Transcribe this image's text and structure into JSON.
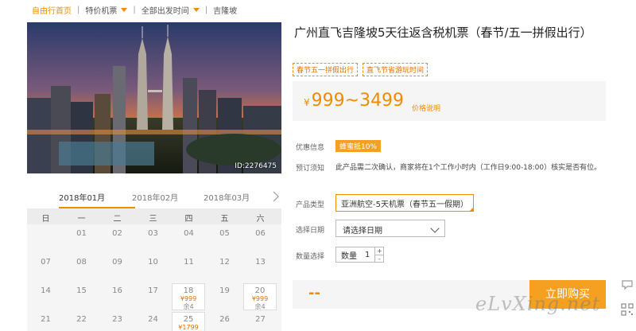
{
  "breadcrumb": {
    "home": "自由行首页",
    "items": [
      "特价机票",
      "全部出发时间",
      "吉隆坡"
    ]
  },
  "photo": {
    "id_label": "ID:2276475"
  },
  "calendar": {
    "months": [
      "2018年01月",
      "2018年02月",
      "2018年03月"
    ],
    "active_month_index": 0,
    "weekdays": [
      "日",
      "一",
      "二",
      "三",
      "四",
      "五",
      "六"
    ],
    "weeks": [
      [
        null,
        {
          "day": "01"
        },
        {
          "day": "02"
        },
        {
          "day": "03"
        },
        {
          "day": "04"
        },
        {
          "day": "05"
        },
        {
          "day": "06"
        }
      ],
      [
        {
          "day": "07"
        },
        {
          "day": "08"
        },
        {
          "day": "09"
        },
        {
          "day": "10"
        },
        {
          "day": "11"
        },
        {
          "day": "12"
        },
        {
          "day": "13"
        }
      ],
      [
        {
          "day": "14"
        },
        {
          "day": "15"
        },
        {
          "day": "16"
        },
        {
          "day": "17"
        },
        {
          "day": "18",
          "price": "¥999",
          "left": "余4"
        },
        {
          "day": "19"
        },
        {
          "day": "20",
          "price": "¥999",
          "left": "余4"
        }
      ],
      [
        {
          "day": "21"
        },
        {
          "day": "22"
        },
        {
          "day": "23"
        },
        {
          "day": "24"
        },
        {
          "day": "25",
          "price": "¥1799",
          "left": ""
        },
        {
          "day": "26"
        },
        {
          "day": "27"
        }
      ]
    ]
  },
  "product": {
    "title": "广州直飞吉隆坡5天往返含税机票（春节/五一拼假出行）",
    "tags": [
      "春节五一拼假出行",
      "直飞节省游玩时间"
    ],
    "price": {
      "currency": "¥",
      "range": "999~3499",
      "note": "价格说明"
    }
  },
  "info": {
    "discount_label": "优惠信息",
    "discount_value": "蜂蜜抵10%",
    "notice_label": "预订须知",
    "notice_text": "此产品需二次确认，商家将在1个工作小时内（工作日9:00-18:00）核实是否有位。"
  },
  "form": {
    "type_label": "产品类型",
    "type_value": "亚洲航空-5天机票（春节五一假期）",
    "date_label": "选择日期",
    "date_value": "请选择日期",
    "qty_label": "数量选择",
    "qty_field_label": "数量",
    "qty_value": "1",
    "qty_plus": "+",
    "qty_minus": "-"
  },
  "buy": {
    "total": "--",
    "button": "立即购买"
  },
  "watermark": "eLvXing.net",
  "colors": {
    "accent": "#f08c00",
    "button": "#f5a020",
    "price": "#e07000"
  }
}
